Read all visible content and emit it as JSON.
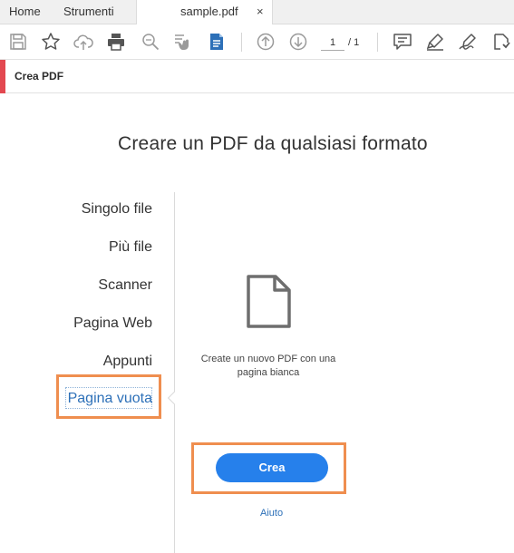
{
  "tabs": {
    "home": "Home",
    "tools": "Strumenti",
    "document": "sample.pdf",
    "close_glyph": "×"
  },
  "toolbar": {
    "icons": [
      "save-icon",
      "star-icon",
      "cloud-upload-icon",
      "print-icon",
      "zoom-icon",
      "scroll-hand-icon",
      "create-pdf-icon",
      "page-up-icon",
      "page-down-icon",
      "comment-icon",
      "highlight-icon",
      "sign-icon",
      "more-tools-icon"
    ],
    "page_current": "1",
    "page_total": "/ 1"
  },
  "panel": {
    "title": "Crea PDF",
    "accent_color": "#e34850"
  },
  "main": {
    "heading": "Creare un PDF da qualsiasi formato",
    "options": [
      {
        "label": "Singolo file"
      },
      {
        "label": "Più file"
      },
      {
        "label": "Scanner"
      },
      {
        "label": "Pagina Web"
      },
      {
        "label": "Appunti"
      },
      {
        "label": "Pagina vuota"
      }
    ],
    "selected_option": "Pagina vuota",
    "description": "Create un nuovo PDF con una pagina bianca",
    "create_button": "Crea",
    "help_link": "Aiuto",
    "button_color": "#2680eb",
    "highlight_color": "#ef8e4f"
  }
}
